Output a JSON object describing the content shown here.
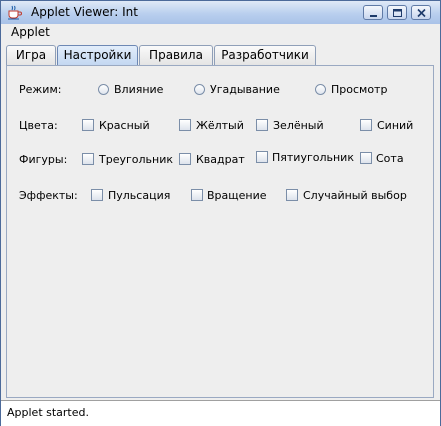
{
  "window": {
    "title": "Applet Viewer: Int"
  },
  "menu": {
    "items": [
      "Applet"
    ]
  },
  "tabs": [
    {
      "label": "Игра",
      "selected": false
    },
    {
      "label": "Настройки",
      "selected": true
    },
    {
      "label": "Правила",
      "selected": false
    },
    {
      "label": "Разработчики",
      "selected": false
    }
  ],
  "settings": {
    "mode": {
      "label": "Режим:",
      "options": [
        "Влияние",
        "Угадывание",
        "Просмотр"
      ],
      "selected": null
    },
    "colors": {
      "label": "Цвета:",
      "options": [
        {
          "label": "Красный",
          "checked": false
        },
        {
          "label": "Жёлтый",
          "checked": false
        },
        {
          "label": "Зелёный",
          "checked": false
        },
        {
          "label": "Синий",
          "checked": false
        }
      ]
    },
    "shapes": {
      "label": "Фигуры:",
      "options": [
        {
          "label": "Треугольник",
          "checked": false
        },
        {
          "label": "Квадрат",
          "checked": false
        },
        {
          "label": "Пятиугольник",
          "checked": false
        },
        {
          "label": "Сота",
          "checked": false
        }
      ]
    },
    "effects": {
      "label": "Эффекты:",
      "options": [
        {
          "label": "Пульсация",
          "checked": false
        },
        {
          "label": "Вращение",
          "checked": false
        },
        {
          "label": "Случайный выбор",
          "checked": false
        }
      ]
    }
  },
  "status": {
    "text": "Applet started."
  },
  "icons": {
    "app": "java-cup-icon",
    "minimize": "minimize-icon",
    "maximize": "maximize-icon",
    "close": "close-icon"
  }
}
